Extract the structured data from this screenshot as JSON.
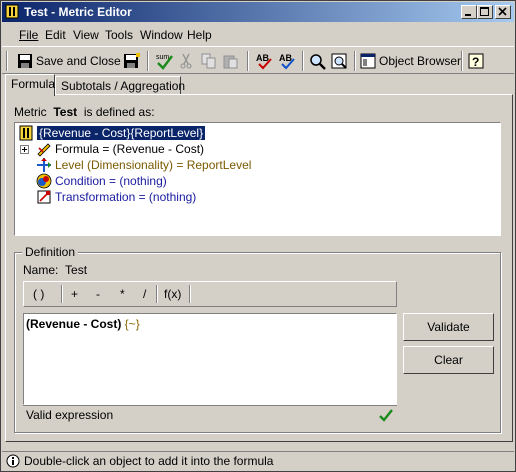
{
  "window": {
    "title": "Test - Metric Editor"
  },
  "menubar": {
    "items": [
      "File",
      "Edit",
      "View",
      "Tools",
      "Window",
      "Help"
    ]
  },
  "toolbar": {
    "save_and_close_label": "Save and Close",
    "object_browser_label": "Object Browser"
  },
  "tabs": [
    {
      "label": "Formula",
      "active": true
    },
    {
      "label": "Subtotals / Aggregation",
      "active": false
    }
  ],
  "metric": {
    "prefix": "Metric",
    "name": "Test",
    "suffix": "is defined as:"
  },
  "tree": {
    "root": "{Revenue - Cost}{ReportLevel}",
    "children": [
      {
        "label": "Formula = (Revenue - Cost)",
        "icon": "formula-icon",
        "color": "#000000"
      },
      {
        "label": "Level (Dimensionality) = ReportLevel",
        "icon": "level-icon",
        "color": "#7a5a00"
      },
      {
        "label": "Condition = (nothing)",
        "icon": "condition-icon",
        "color": "#1a1aa0"
      },
      {
        "label": "Transformation = (nothing)",
        "icon": "transformation-icon",
        "color": "#1a1aa0"
      }
    ]
  },
  "definition": {
    "group_label": "Definition",
    "name_label": "Name:",
    "name_value": "Test",
    "operators": [
      "( )",
      "+",
      "-",
      "*",
      "/",
      "f(x)"
    ],
    "expression_bold": "(Revenue - Cost)",
    "expression_rest": " {~}",
    "status": "Valid expression",
    "validate_label": "Validate",
    "clear_label": "Clear"
  },
  "statusbar": {
    "text": "Double-click an object to add it into the formula"
  }
}
